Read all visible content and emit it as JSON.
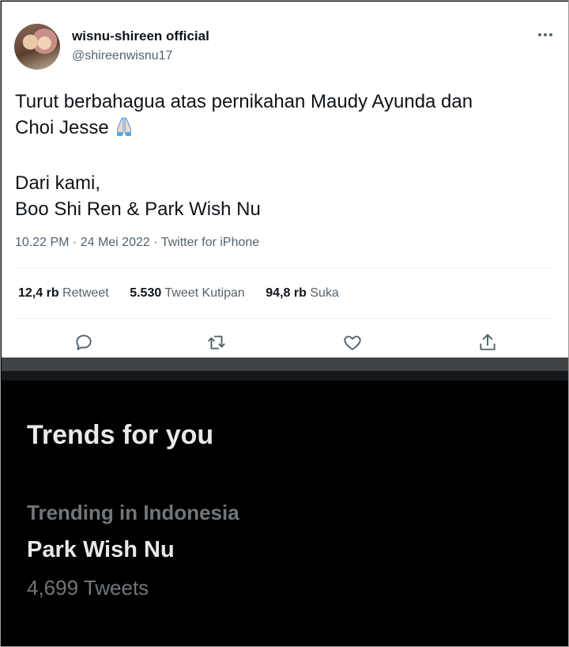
{
  "tweet": {
    "author_name": "wisnu-shireen official",
    "author_handle": "@shireenwisnu17",
    "more_icon": "ellipsis-icon",
    "text_line1": "Turut berbahagua atas pernikahan Maudy Ayunda dan",
    "text_line2": "Choi Jesse",
    "emoji": "folded-hands-emoji",
    "text_line3": "Dari kami,",
    "text_line4": "Boo Shi Ren & Park Wish Nu",
    "timestamp": "10.22 PM · 24 Mei 2022 · Twitter for iPhone",
    "stats": {
      "retweets_count": "12,4 rb",
      "retweets_label": "Retweet",
      "quotes_count": "5.530",
      "quotes_label": "Tweet Kutipan",
      "likes_count": "94,8 rb",
      "likes_label": "Suka"
    },
    "actions": [
      "reply-icon",
      "retweet-icon",
      "like-icon",
      "share-icon"
    ]
  },
  "trends": {
    "title": "Trends for you",
    "context": "Trending in Indonesia",
    "name": "Park Wish Nu",
    "count": "4,699 Tweets"
  },
  "colors": {
    "text_primary": "#0f1419",
    "text_secondary": "#536471",
    "dark_bg": "#000000",
    "dark_text": "#e7e9ea",
    "dark_muted": "#71767b"
  }
}
